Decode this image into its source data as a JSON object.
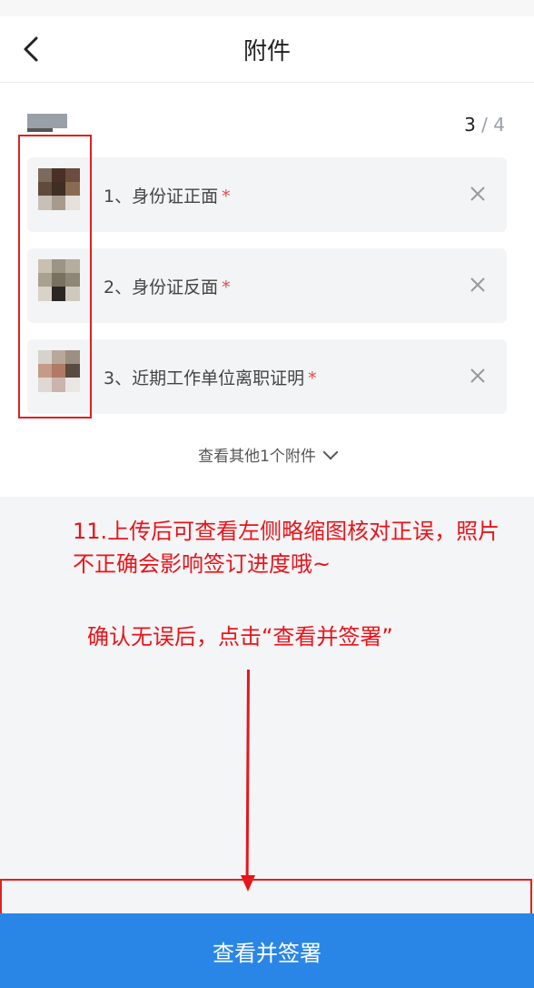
{
  "header": {
    "title": "附件"
  },
  "counter": {
    "current": "3",
    "separator": "/",
    "total": "4"
  },
  "attachments": [
    {
      "label": "1、身份证正面",
      "required_mark": "*"
    },
    {
      "label": "2、身份证反面",
      "required_mark": "*"
    },
    {
      "label": "3、近期工作单位离职证明",
      "required_mark": "*"
    }
  ],
  "more_link": {
    "label": "查看其他1个附件"
  },
  "annotations": {
    "step_note_line1": "11.上传后可查看左侧略缩图核对正误，照片",
    "step_note_line2": "不正确会影响签订进度哦~",
    "confirm_note": "确认无误后，点击“查看并签署”"
  },
  "footer": {
    "button_label": "查看并签署"
  },
  "colors": {
    "primary": "#2a86e6",
    "annotation": "#e8141b",
    "required": "#e5484d"
  },
  "icons": {
    "back": "chevron-left-icon",
    "remove": "close-icon",
    "expand": "chevron-down-icon"
  }
}
